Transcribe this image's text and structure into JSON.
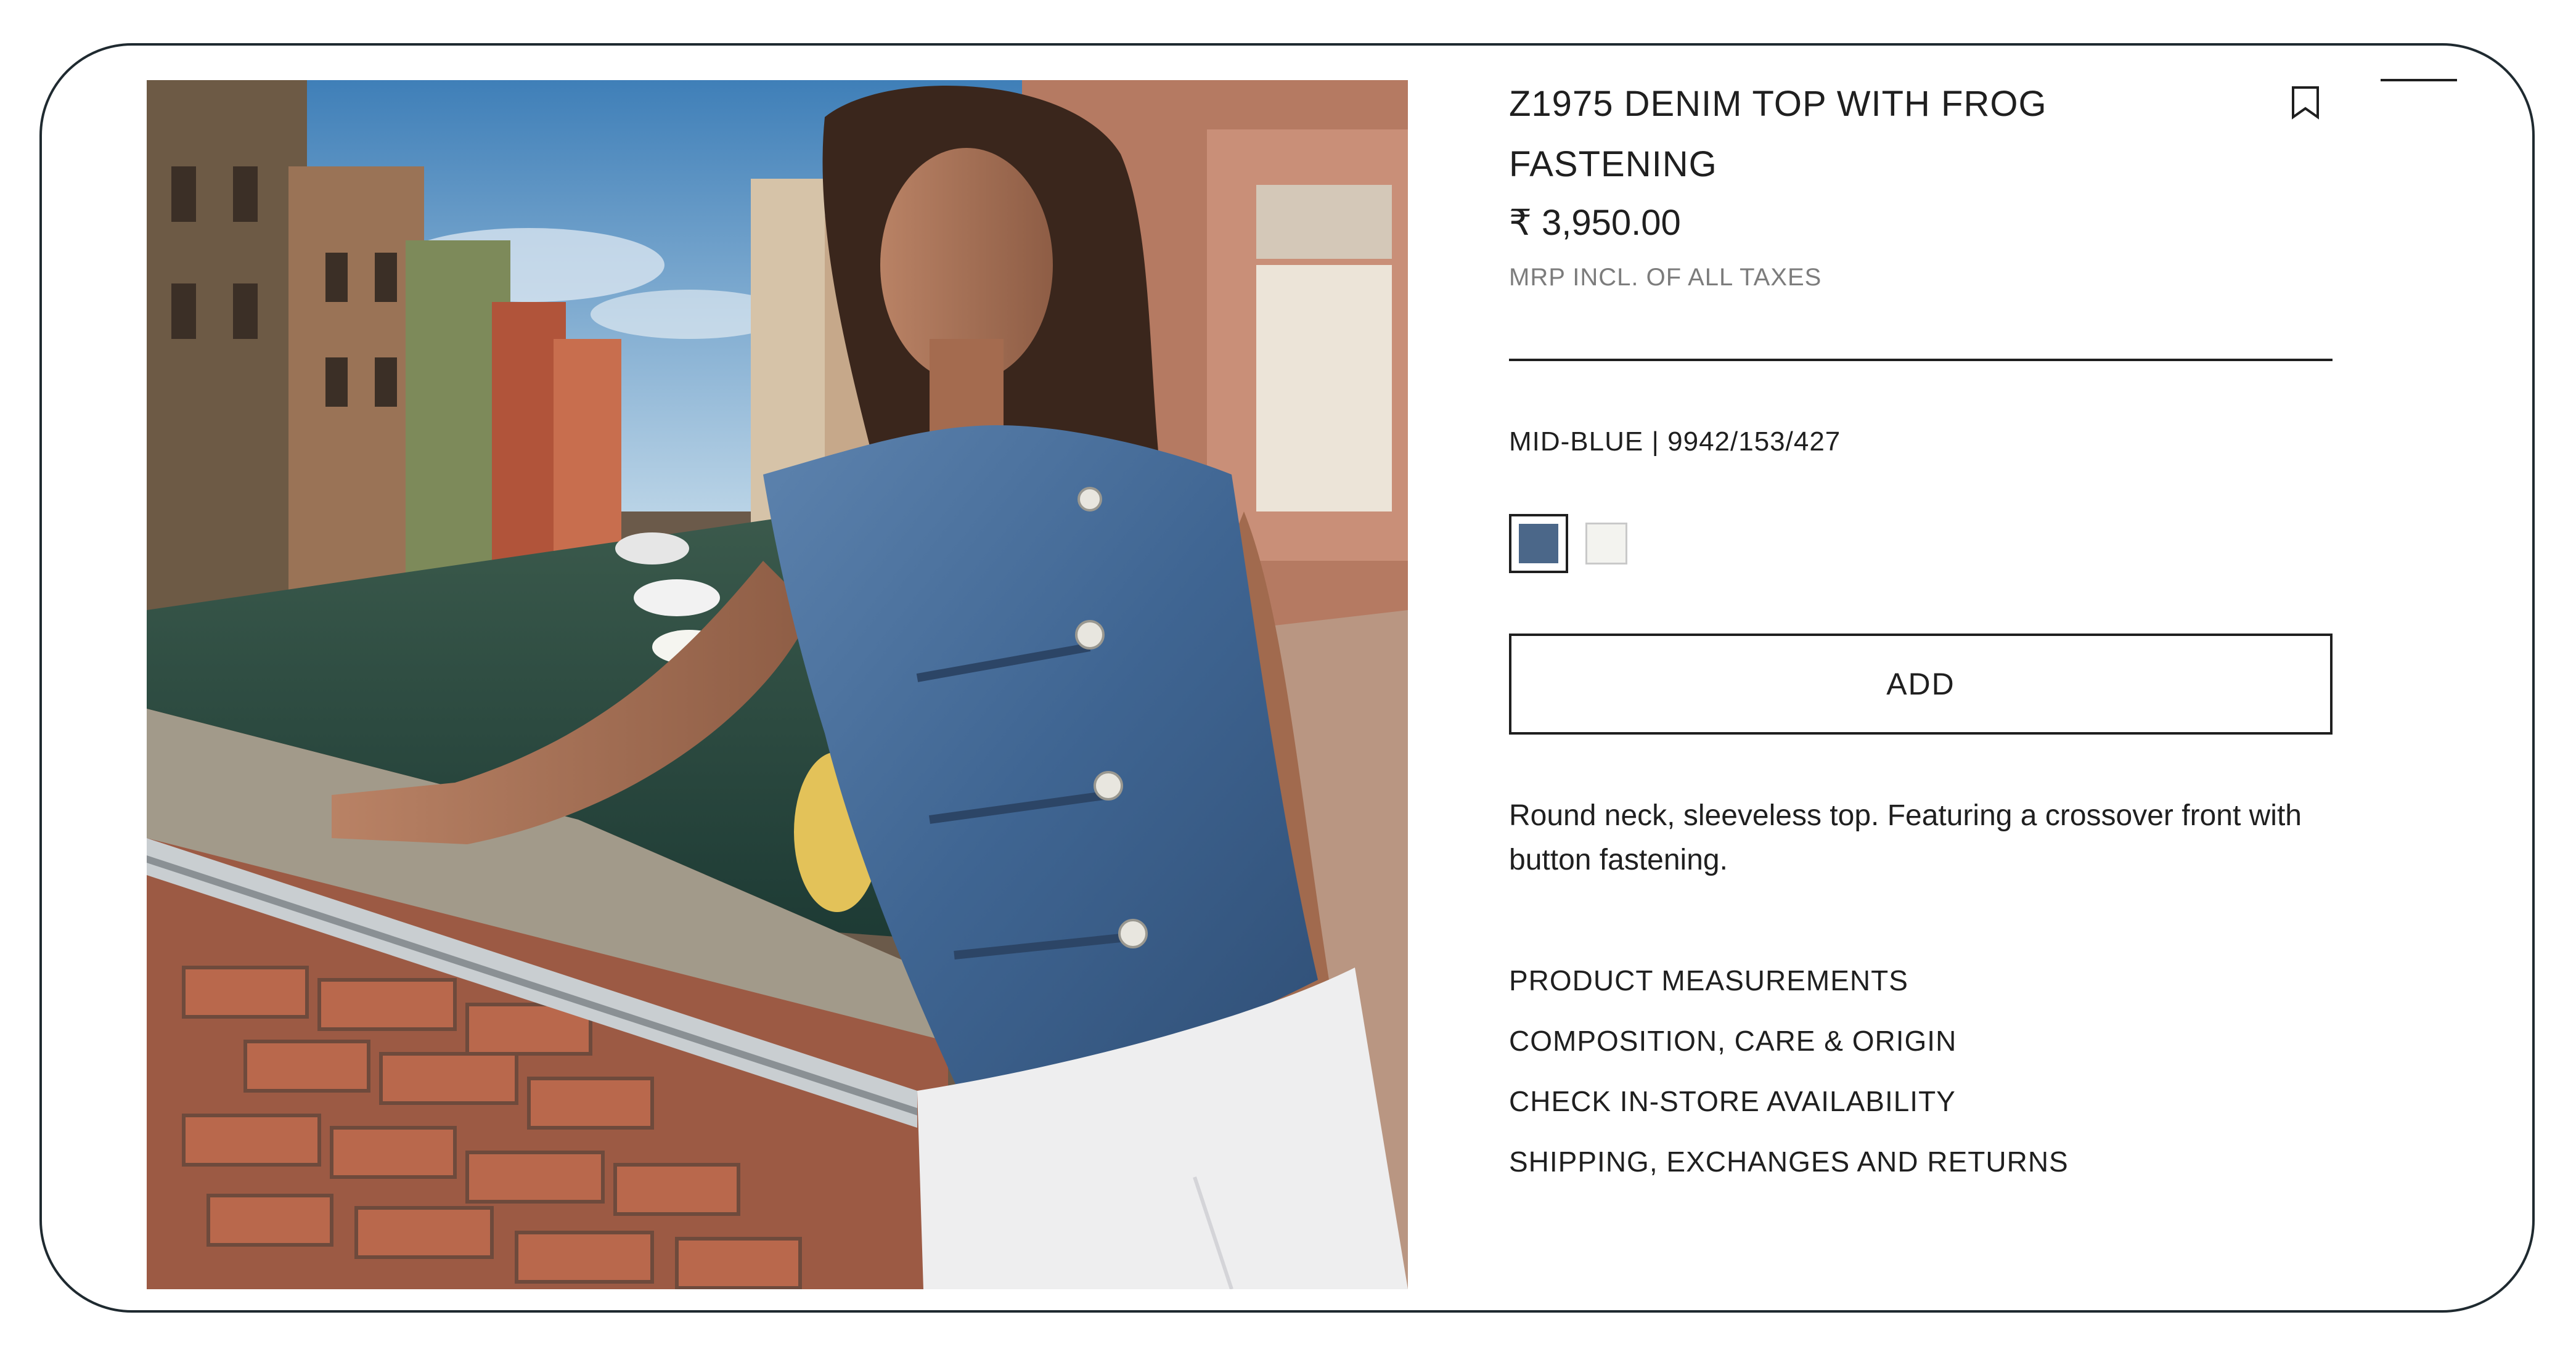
{
  "product": {
    "title": "Z1975 DENIM TOP WITH FROG FASTENING",
    "price": "₹ 3,950.00",
    "tax_note": "MRP INCL. OF ALL TAXES",
    "color_ref": "MID-BLUE | 9942/153/427",
    "swatches": [
      {
        "name": "mid-blue",
        "color": "#4b6789",
        "selected": true
      },
      {
        "name": "white",
        "color": "#f3f3ef",
        "selected": false
      }
    ],
    "add_label": "ADD",
    "description": "Round neck, sleeveless top. Featuring a crossover front with button fastening."
  },
  "links": [
    "PRODUCT MEASUREMENTS",
    "COMPOSITION, CARE & ORIGIN",
    "CHECK IN-STORE AVAILABILITY",
    "SHIPPING, EXCHANGES AND RETURNS"
  ],
  "icons": {
    "bookmark": "bookmark-icon",
    "menu_dash": "minimize-dash-icon"
  }
}
